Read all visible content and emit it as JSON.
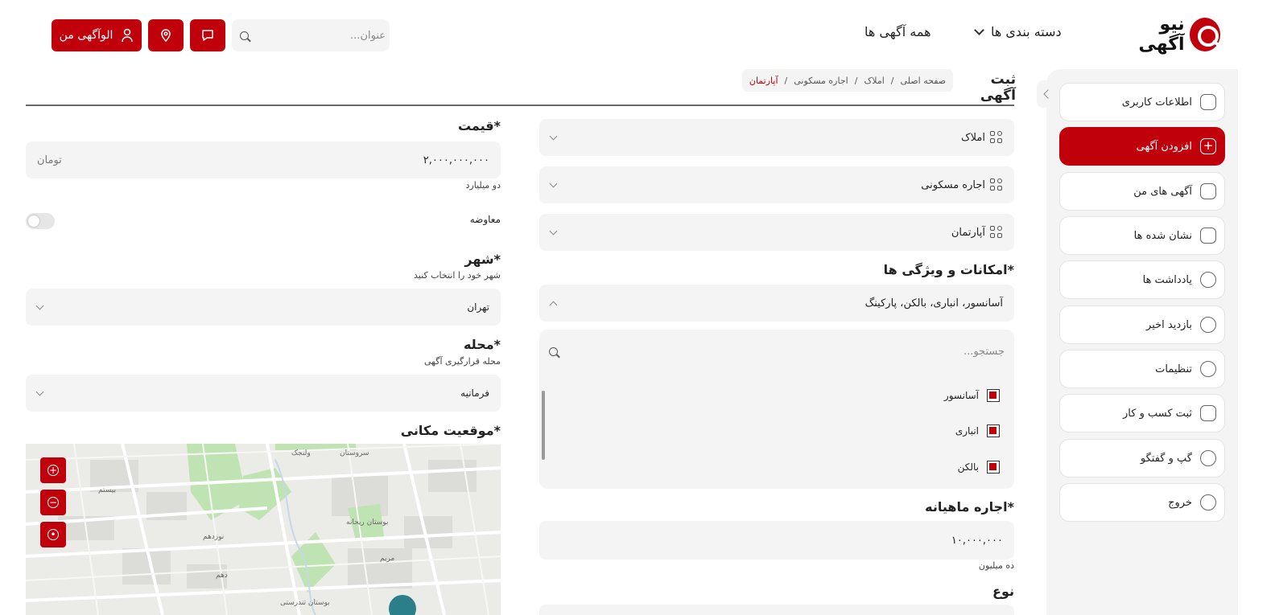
{
  "header": {
    "logo_text": "نیو آگهی",
    "categories_label": "دسته بندی ها",
    "all_ads_label": "همه آگهی ها",
    "search_placeholder": "عنوان...",
    "my_ads_button": "الوآگهی من"
  },
  "sidebar": {
    "items": [
      {
        "label": "اطلاعات کاربری",
        "icon": "user-shield-icon"
      },
      {
        "label": "افزودن آگهی",
        "icon": "plus-square-icon",
        "active": true
      },
      {
        "label": "آگهی های من",
        "icon": "document-list-icon"
      },
      {
        "label": "نشان شده ها",
        "icon": "bookmark-icon"
      },
      {
        "label": "یادداشت ها",
        "icon": "note-icon"
      },
      {
        "label": "بازدید اخیر",
        "icon": "clock-icon"
      },
      {
        "label": "تنظیمات",
        "icon": "gear-icon"
      },
      {
        "label": "ثبت کسب و کار",
        "icon": "store-icon"
      },
      {
        "label": "گپ و گفتگو",
        "icon": "person-icon"
      },
      {
        "label": "خروج",
        "icon": "logout-icon"
      }
    ]
  },
  "page": {
    "title": "ثبت آگهی",
    "breadcrumb": [
      "صفحه اصلی",
      "املاک",
      "اجاره مسکونی",
      "آپارتمان"
    ]
  },
  "form": {
    "category_selects": [
      "املاک",
      "اجاره مسکونی",
      "آپارتمان"
    ],
    "features_title": "امکانات و ویژگی ها*",
    "features_value": "آسانسور، انباری، بالکن، پارکینگ",
    "features_search_placeholder": "جستجو...",
    "features_options": [
      {
        "label": "آسانسور",
        "checked": true
      },
      {
        "label": "انباری",
        "checked": true
      },
      {
        "label": "بالکن",
        "checked": true
      }
    ],
    "rent_title": "اجاره ماهیانه*",
    "rent_value": "۱۰,۰۰۰,۰۰۰",
    "rent_words": "ده میلیون",
    "type_title": "نوع",
    "price_title": "قیمت*",
    "price_value": "۲,۰۰۰,۰۰۰,۰۰۰",
    "price_unit": "تومان",
    "price_words": "دو میلیارد",
    "swap_label": "معاوضه",
    "swap_on": false,
    "city_title": "شهر*",
    "city_help": "شهر خود را انتخاب کنید",
    "city_value": "تهران",
    "neighborhood_title": "محله*",
    "neighborhood_help": "محله قرارگیری آگهی",
    "neighborhood_value": "فرمانیه",
    "location_title": "موقعیت مکانی*"
  },
  "map": {
    "labels": [
      "سروستان",
      "ولنجک",
      "بوستان ریحانه",
      "نوزدهم",
      "بیستم",
      "بوستان تندرستی",
      "دهم",
      "مریم"
    ]
  },
  "colors": {
    "accent": "#c0000a",
    "panel": "#f4f4f4"
  }
}
